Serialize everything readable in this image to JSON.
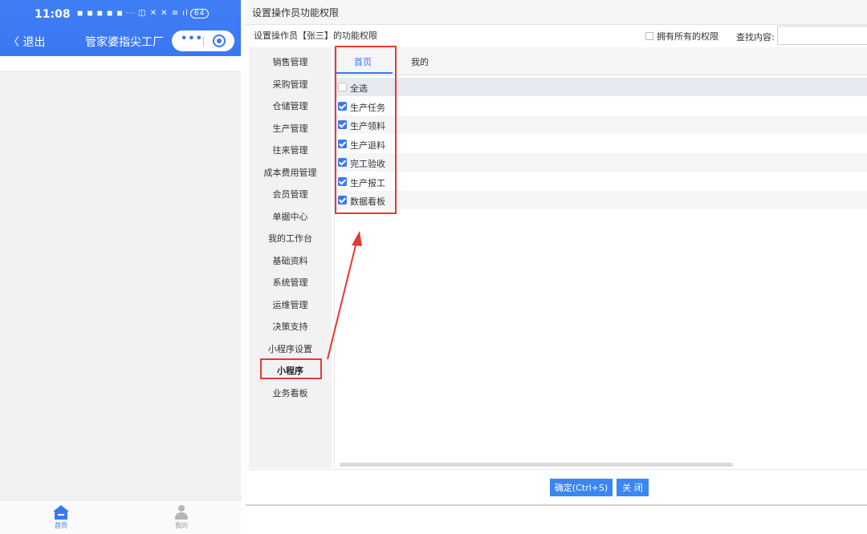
{
  "phone": {
    "status_time": "11:08",
    "status_icons": "◼ ◼ ◼ ◼ ◼ ···",
    "status_right": "◫ ✕ ✕ ≋ ıl",
    "battery": "64",
    "back_label": "退出",
    "app_title": "管家婆指尖工厂",
    "capsule_dots": "•••",
    "tab_home": "首页",
    "tab_mine": "我的",
    "accent_color": "#3a78f2"
  },
  "dialog": {
    "title": "设置操作员功能权限",
    "subtitle": "设置操作员【张三】的功能权限",
    "all_permissions_label": "拥有所有的权限",
    "search_label": "查找内容:",
    "search_value": "",
    "left_nav": [
      "销售管理",
      "采购管理",
      "仓储管理",
      "生产管理",
      "往来管理",
      "成本费用管理",
      "会员管理",
      "单据中心",
      "我的工作台",
      "基础资料",
      "系统管理",
      "运维管理",
      "决策支持",
      "小程序设置",
      "小程序",
      "业务看板"
    ],
    "left_nav_active_index": 14,
    "tabs": [
      "首页",
      "我的"
    ],
    "select_all_label": "全选",
    "items": [
      {
        "label": "生产任务",
        "checked": true
      },
      {
        "label": "生产领料",
        "checked": true
      },
      {
        "label": "生产退料",
        "checked": true
      },
      {
        "label": "完工验收",
        "checked": true
      },
      {
        "label": "生产报工",
        "checked": true
      },
      {
        "label": "数据看板",
        "checked": true
      }
    ],
    "ok_button": "确定(Ctrl+S)",
    "close_button": "关 闭",
    "highlight_color": "#e53935"
  }
}
